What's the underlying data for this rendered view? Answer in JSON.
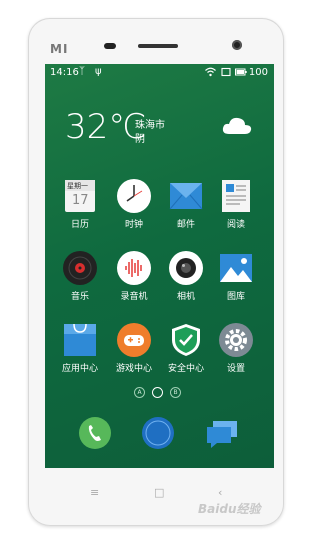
{
  "device": {
    "brand": "MI"
  },
  "status_bar": {
    "time": "14:16",
    "battery": "100"
  },
  "weather": {
    "temperature": "32℃",
    "city": "珠海市",
    "condition": "阴"
  },
  "apps": [
    {
      "label": "日历",
      "icon": "calendar-icon",
      "badge_top": "星期一",
      "badge_num": "17"
    },
    {
      "label": "时钟",
      "icon": "clock-icon"
    },
    {
      "label": "邮件",
      "icon": "mail-icon"
    },
    {
      "label": "阅读",
      "icon": "book-icon"
    },
    {
      "label": "音乐",
      "icon": "music-icon"
    },
    {
      "label": "录音机",
      "icon": "recorder-icon"
    },
    {
      "label": "相机",
      "icon": "camera-icon"
    },
    {
      "label": "图库",
      "icon": "gallery-icon"
    },
    {
      "label": "应用中心",
      "icon": "app-store-icon"
    },
    {
      "label": "游戏中心",
      "icon": "gamepad-icon"
    },
    {
      "label": "安全中心",
      "icon": "shield-check-icon"
    },
    {
      "label": "设置",
      "icon": "gear-icon"
    }
  ],
  "page_indicator": [
    "A",
    "",
    "B"
  ],
  "dock": [
    "phone-icon",
    "compass-icon",
    "message-icon"
  ],
  "nav": {
    "menu": "≡",
    "home": "□",
    "back": "‹"
  },
  "watermark": "Baidu经验",
  "colors": {
    "screen_bg": "#0f6a3f",
    "mail": "#2f8ad6",
    "music": "#222222",
    "game": "#ef7d2c",
    "settings": "#7d8a94",
    "phone": "#57b85a",
    "compass": "#1f6fc2",
    "message": "#2f8ad6"
  }
}
